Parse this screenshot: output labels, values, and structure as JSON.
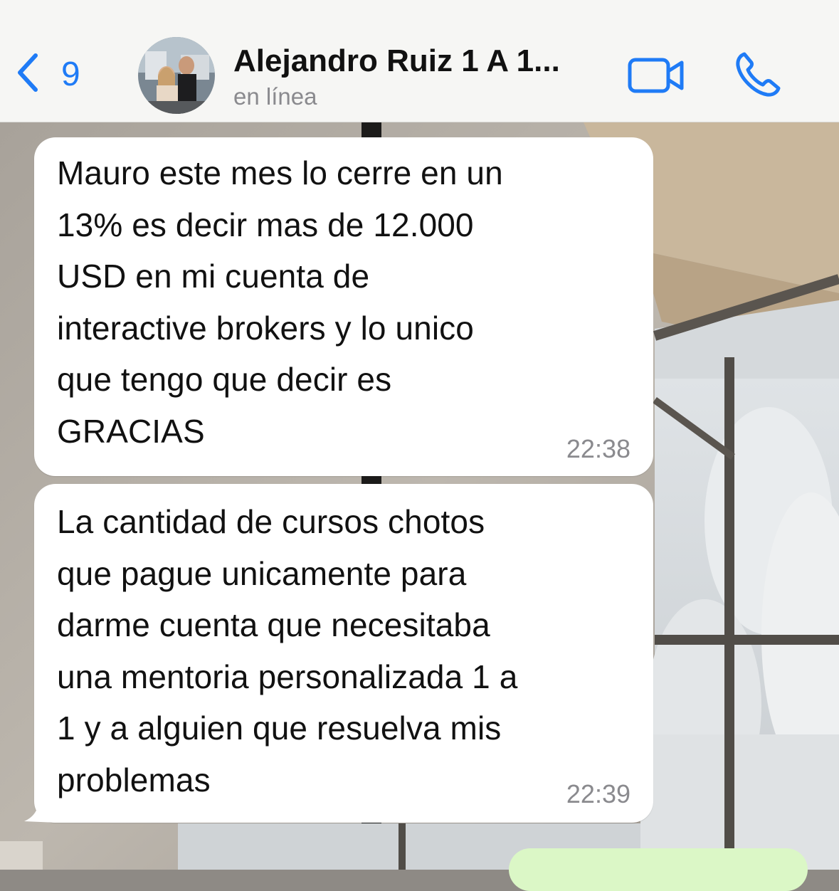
{
  "header": {
    "back_count": "9",
    "contact_name": "Alejandro Ruiz 1 A 1...",
    "status": "en línea",
    "back_icon": "chevron-left-icon",
    "video_icon": "video-camera-icon",
    "call_icon": "phone-icon",
    "accent_color": "#1f7bf6"
  },
  "messages": [
    {
      "text": "Mauro este mes lo cerre en un\n13% es decir mas de 12.000\nUSD en mi cuenta de\ninteractive brokers y lo unico\nque tengo que decir es\nGRACIAS",
      "time": "22:38"
    },
    {
      "text": "La cantidad de cursos chotos\nque pague unicamente para\ndarme cuenta que necesitaba\nuna mentoria personalizada 1 a\n1 y a alguien que resuelva mis\nproblemas",
      "time": "22:39"
    }
  ]
}
